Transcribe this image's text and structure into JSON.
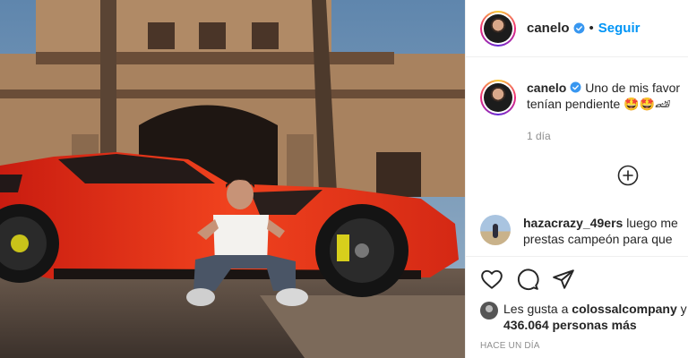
{
  "header": {
    "username": "canelo",
    "separator": "•",
    "follow_label": "Seguir"
  },
  "caption": {
    "username": "canelo",
    "text_line1": "Uno de mis favor",
    "text_line2": "tenían pendiente 🤩🤩🏎",
    "age": "1 día"
  },
  "comment": {
    "username": "hazacrazy_49ers",
    "text_line1": "luego me",
    "text_line2": "prestas campeón para que"
  },
  "likes": {
    "prefix": "Les gusta a",
    "user": "colossalcompany",
    "suffix": "y",
    "count": "436.064 personas más"
  },
  "timestamp": "HACE UN DÍA",
  "icons": {
    "verified": "verified-badge-icon",
    "add": "add-comment-circle-icon",
    "like": "heart-icon",
    "comment": "comment-bubble-icon",
    "share": "paper-plane-icon"
  },
  "colors": {
    "accent": "#0095f6",
    "verified": "#3897f0",
    "muted": "#8e8e8e",
    "car": "#e8301e"
  }
}
